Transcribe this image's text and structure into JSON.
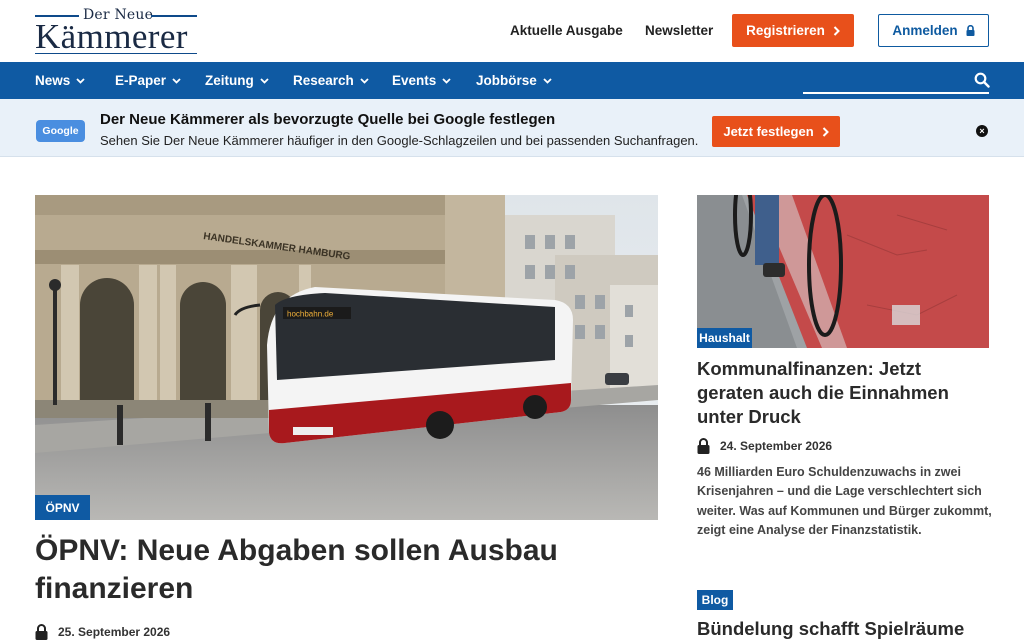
{
  "logo": {
    "top_text": "Der Neue",
    "main_text": "Kämmerer"
  },
  "header": {
    "links": [
      "Aktuelle Ausgabe",
      "Newsletter"
    ],
    "register_label": "Registrieren",
    "login_label": "Anmelden"
  },
  "nav": {
    "items": [
      {
        "label": "News"
      },
      {
        "label": "E-Paper"
      },
      {
        "label": "Zeitung"
      },
      {
        "label": "Research"
      },
      {
        "label": "Events"
      },
      {
        "label": "Jobbörse"
      }
    ]
  },
  "google_banner": {
    "badge": "Google",
    "title": "Der Neue Kämmerer als bevorzugte Quelle bei Google festlegen",
    "subtitle": "Sehen Sie Der Neue Kämmerer häufiger in den Google-Schlagzeilen und bei passenden Suchanfragen.",
    "button_label": "Jetzt festlegen"
  },
  "main_article": {
    "tag": "ÖPNV",
    "title": "ÖPNV: Neue Abgaben sollen Ausbau finanzieren",
    "date": "25. September 2026",
    "image_text_building": "HANDELSKAMMER HAMBURG",
    "image_text_bus": "hochbahn.de"
  },
  "side_article_1": {
    "tag": "Haushalt",
    "title": "Kommunalfinanzen: Jetzt geraten auch die Einnahmen unter Druck",
    "date": "24. September 2026",
    "text": "46 Milliarden Euro Schuldenzuwachs in zwei Krisenjahren – und die Lage verschlechtert sich weiter. Was auf Kommunen und Bürger zukommt, zeigt eine Analyse der Finanzstatistik."
  },
  "side_article_2": {
    "tag": "Blog",
    "title": "Bündelung schafft Spielräume"
  },
  "colors": {
    "brand_blue": "#0f5aa3",
    "accent_orange": "#e8501b",
    "banner_bg": "#e9f1f9"
  },
  "icons": {
    "search": "search-icon",
    "lock": "lock-icon",
    "chevron": "chevron-right-icon",
    "dropdown": "chevron-down-icon",
    "close": "close-icon"
  }
}
